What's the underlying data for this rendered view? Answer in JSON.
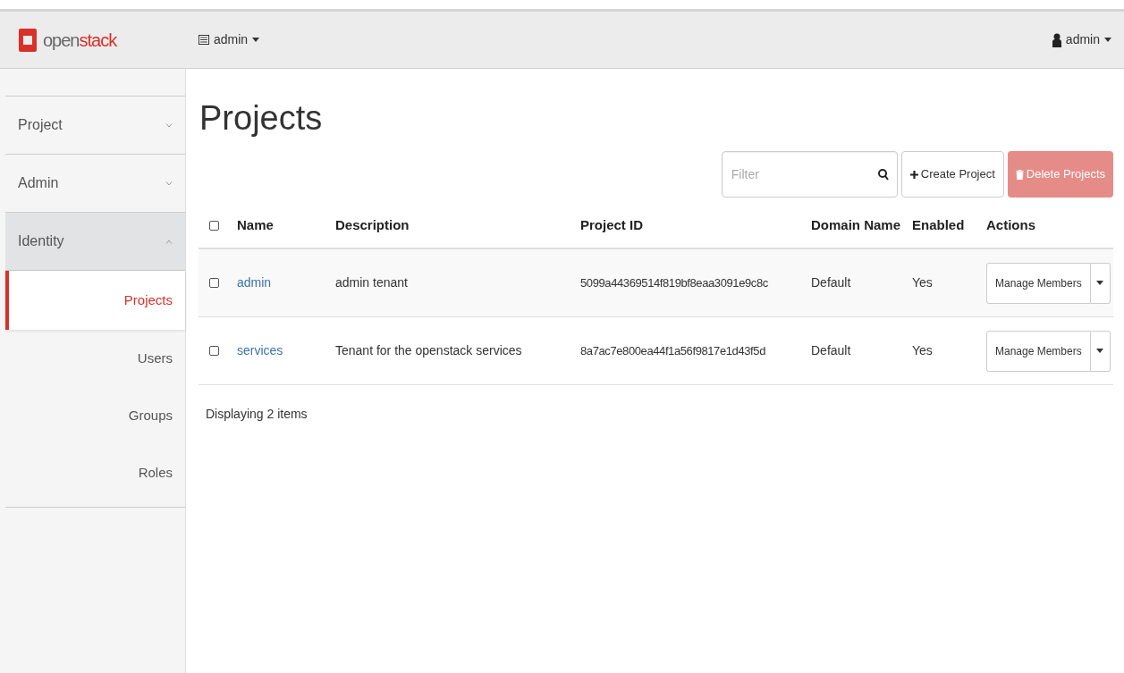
{
  "logo": {
    "part_1": "open",
    "part_2": "stack"
  },
  "topbar": {
    "project_menu": "admin",
    "user_menu": "admin"
  },
  "sidebar": {
    "sections": [
      {
        "label": "Project",
        "expanded": false
      },
      {
        "label": "Admin",
        "expanded": false
      },
      {
        "label": "Identity",
        "expanded": true,
        "children": [
          {
            "label": "Projects",
            "selected": true
          },
          {
            "label": "Users",
            "selected": false
          },
          {
            "label": "Groups",
            "selected": false
          },
          {
            "label": "Roles",
            "selected": false
          }
        ]
      }
    ]
  },
  "page_title": "Projects",
  "filter": {
    "placeholder": "Filter"
  },
  "buttons": {
    "create": "Create Project",
    "delete": "Delete Projects"
  },
  "table": {
    "select_all_checked": false,
    "columns": [
      "Name",
      "Description",
      "Project ID",
      "Domain Name",
      "Enabled",
      "Actions"
    ],
    "rows": [
      {
        "checked": false,
        "name": "admin",
        "description": "admin tenant",
        "project_id": "5099a44369514f819bf8eaa3091e9c8c",
        "domain": "Default",
        "enabled": "Yes",
        "action": "Manage Members"
      },
      {
        "checked": false,
        "name": "services",
        "description": "Tenant for the openstack services",
        "project_id": "8a7ac7e800ea44f1a56f9817e1d43f5d",
        "domain": "Default",
        "enabled": "Yes",
        "action": "Manage Members"
      }
    ],
    "footer": "Displaying 2 items"
  }
}
